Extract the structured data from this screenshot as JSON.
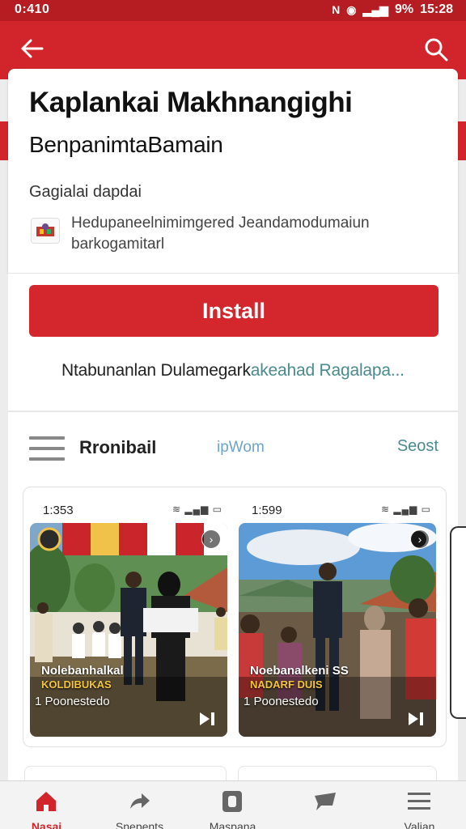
{
  "status_bar": {
    "time": "0:410",
    "battery": "9%",
    "clock": "15:28"
  },
  "card": {
    "title": "Kaplankai Makhnangighi",
    "subtitle": "BenpanimtaBamain",
    "developer": "Gagialai dapdai",
    "description": "Hedupaneelnimimgered Jeandamodumaiun barkogamitarl"
  },
  "install_label": "Install",
  "notice": {
    "main": "Ntabunanlan Dulamegark",
    "tail": "akeahad Ragalapa..."
  },
  "section": {
    "title": "Rronibail",
    "mid": "ipWom",
    "right": "Seost"
  },
  "screenshots": [
    {
      "time": "1:353",
      "status_icons": "≋ ▂▄▆ ▭",
      "caption1": "Nolebanhalkal",
      "caption2": "KOLDIBUKAS",
      "caption3": "1 Poonestedo"
    },
    {
      "time": "1:599",
      "status_icons": "≋ ▂▄▆ ▭",
      "caption1": "Noebanalkeni SS",
      "caption2": "NADARF DUIS",
      "caption3": "1 Poonestedo"
    }
  ],
  "bottom_nav": [
    {
      "label": "Nasai",
      "icon": "home-icon",
      "active": true
    },
    {
      "label": "Snepents",
      "icon": "forward-icon",
      "active": false
    },
    {
      "label": "Maspana",
      "icon": "app-icon",
      "active": false
    },
    {
      "label": "",
      "icon": "chat-icon",
      "active": false
    },
    {
      "label": "Valian",
      "icon": "menu-icon",
      "active": false
    }
  ],
  "colors": {
    "brand_red": "#d2252b",
    "accent_teal": "#4a8b8c"
  }
}
